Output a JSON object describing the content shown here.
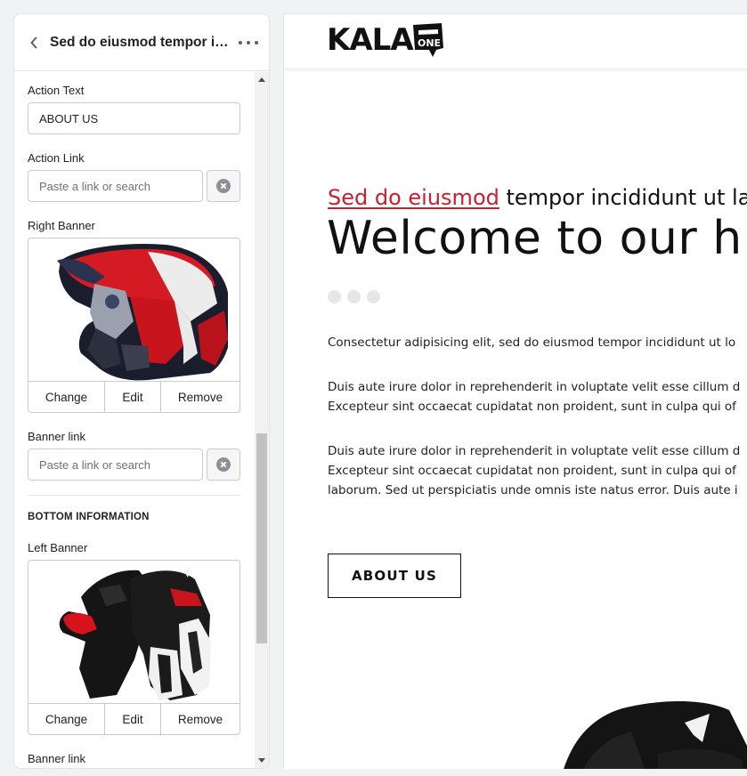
{
  "panel": {
    "title": "Sed do eiusmod tempor in...",
    "action_text": {
      "label": "Action Text",
      "value": "ABOUT US"
    },
    "action_link": {
      "label": "Action Link",
      "placeholder": "Paste a link or search"
    },
    "right_banner": {
      "label": "Right Banner",
      "image": "motocross-helmet-image",
      "actions": [
        "Change",
        "Edit",
        "Remove"
      ]
    },
    "banner_link_1": {
      "label": "Banner link",
      "placeholder": "Paste a link or search"
    },
    "bottom_section": {
      "heading": "BOTTOM INFORMATION"
    },
    "left_banner": {
      "label": "Left Banner",
      "image": "racing-gloves-image",
      "actions": [
        "Change",
        "Edit",
        "Remove"
      ]
    },
    "banner_link_2": {
      "label": "Banner link"
    }
  },
  "preview": {
    "logo_text": "KALA",
    "logo_badge": "ONE",
    "subtitle_highlight": "Sed do eiusmod",
    "subtitle_rest": " tempor incididunt ut la",
    "title": "Welcome to our h",
    "paragraphs": [
      [
        "Consectetur adipisicing elit, sed do eiusmod tempor incididunt ut lo"
      ],
      [
        "Duis aute irure dolor in reprehenderit in voluptate velit esse cillum d",
        "Excepteur sint occaecat cupidatat non proident, sunt in culpa qui of"
      ],
      [
        "Duis aute irure dolor in reprehenderit in voluptate velit esse cillum d",
        "Excepteur sint occaecat cupidatat non proident, sunt in culpa qui of",
        "laborum. Sed ut perspiciatis unde omnis iste natus error. Duis aute i"
      ]
    ],
    "button_label": "ABOUT US"
  },
  "colors": {
    "accent_red": "#c8202f",
    "border": "#c9cccf",
    "text": "#202223"
  }
}
